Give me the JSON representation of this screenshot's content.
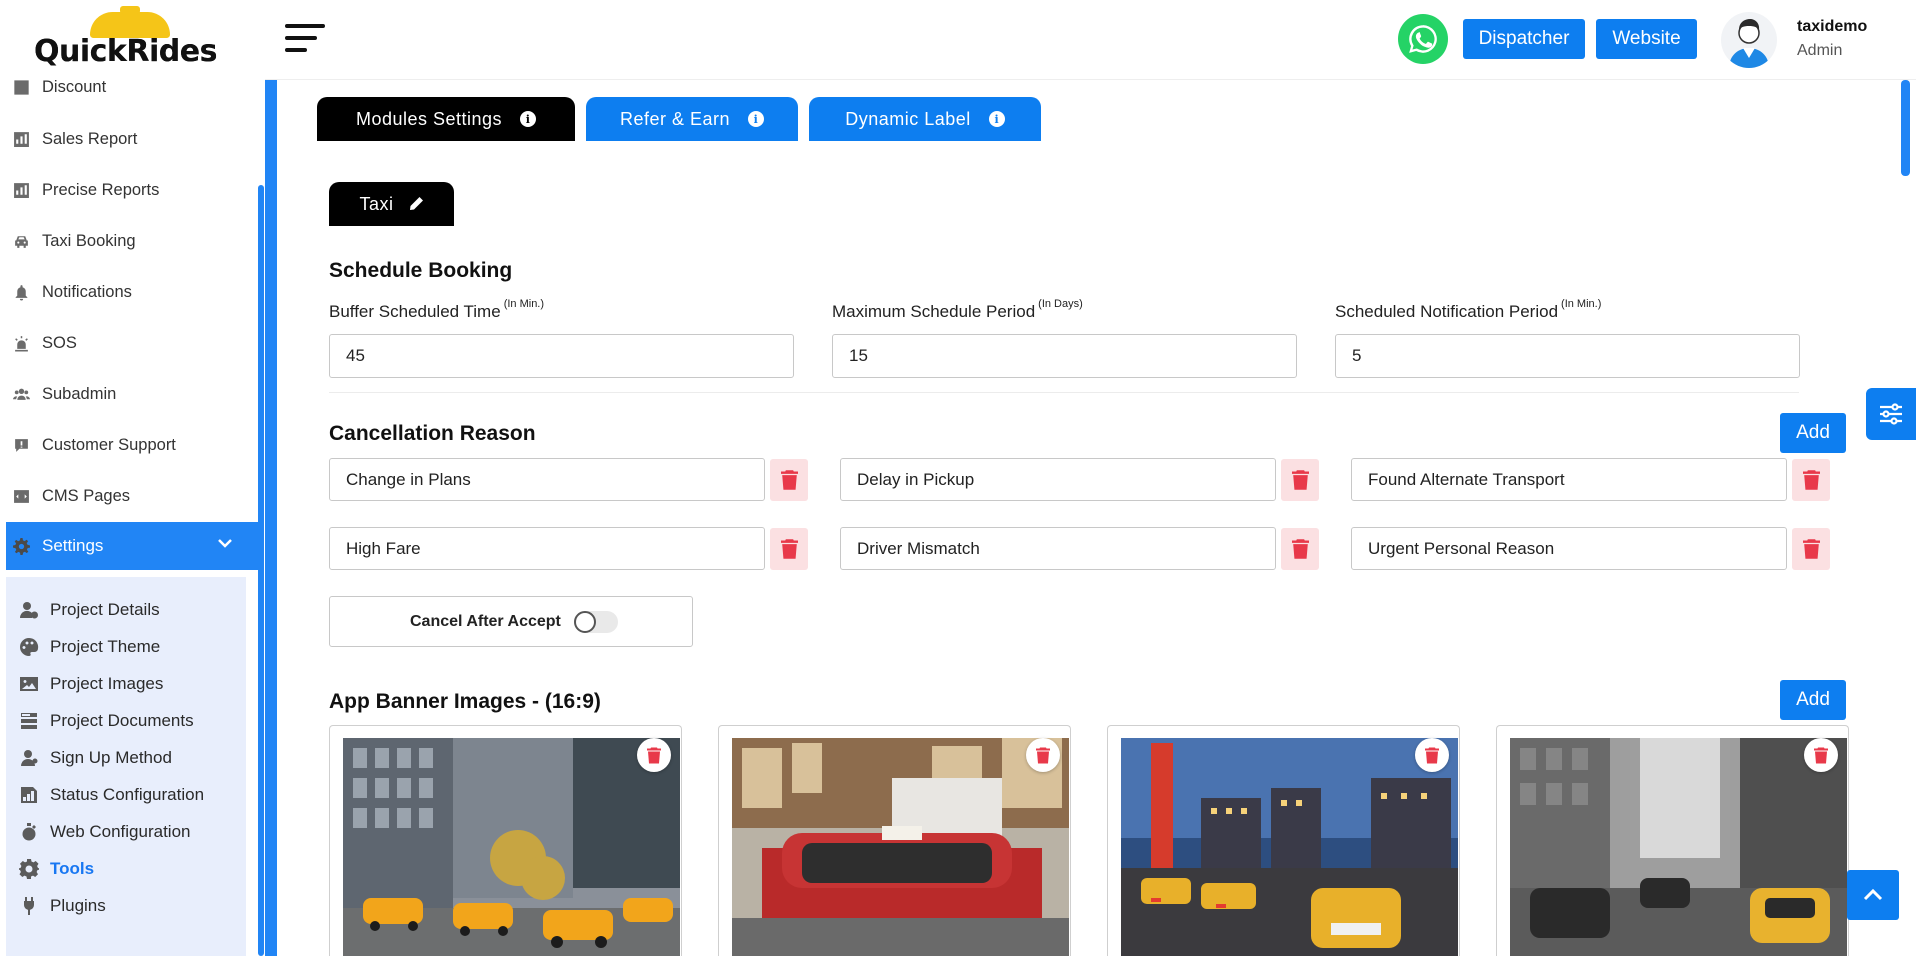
{
  "brand": {
    "logo_text": "QuickRides"
  },
  "header": {
    "dispatcher_label": "Dispatcher",
    "website_label": "Website",
    "user_name": "taxidemo",
    "user_role": "Admin"
  },
  "sidebar": {
    "items": [
      {
        "label": "Discount",
        "icon": "percent-icon"
      },
      {
        "label": "Sales Report",
        "icon": "chart-icon"
      },
      {
        "label": "Precise Reports",
        "icon": "chart-icon"
      },
      {
        "label": "Taxi Booking",
        "icon": "car-icon"
      },
      {
        "label": "Notifications",
        "icon": "bell-icon"
      },
      {
        "label": "SOS",
        "icon": "alarm-icon"
      },
      {
        "label": "Subadmin",
        "icon": "users-icon"
      },
      {
        "label": "Customer Support",
        "icon": "chat-icon"
      },
      {
        "label": "CMS Pages",
        "icon": "code-icon"
      }
    ],
    "active": {
      "label": "Settings",
      "icon": "gear-icon"
    },
    "subitems": [
      {
        "label": "Project Details",
        "icon": "user-gear-icon"
      },
      {
        "label": "Project Theme",
        "icon": "palette-icon"
      },
      {
        "label": "Project Images",
        "icon": "image-icon"
      },
      {
        "label": "Project Documents",
        "icon": "documents-icon"
      },
      {
        "label": "Sign Up Method",
        "icon": "user-icon"
      },
      {
        "label": "Status Configuration",
        "icon": "status-icon"
      },
      {
        "label": "Web Configuration",
        "icon": "web-icon"
      },
      {
        "label": "Tools",
        "icon": "tools-icon"
      },
      {
        "label": "Plugins",
        "icon": "plug-icon"
      }
    ]
  },
  "tabs": {
    "modules": "Modules Settings",
    "refer": "Refer & Earn",
    "dynamic": "Dynamic Label"
  },
  "module_pill": "Taxi",
  "schedule": {
    "title": "Schedule Booking",
    "fields": [
      {
        "label": "Buffer Scheduled Time",
        "unit": "(In Min.)",
        "value": "45"
      },
      {
        "label": "Maximum Schedule Period",
        "unit": "(In Days)",
        "value": "15"
      },
      {
        "label": "Scheduled Notification Period",
        "unit": "(In Min.)",
        "value": "5"
      }
    ]
  },
  "cancellation": {
    "title": "Cancellation Reason",
    "add_label": "Add",
    "reasons": [
      "Change in Plans",
      "Delay in Pickup",
      "Found Alternate Transport",
      "High Fare",
      "Driver Mismatch",
      "Urgent Personal Reason"
    ],
    "cancel_after_accept_label": "Cancel After Accept",
    "cancel_after_accept_on": false
  },
  "banners": {
    "title": "App Banner Images - (16:9)",
    "add_label": "Add"
  }
}
